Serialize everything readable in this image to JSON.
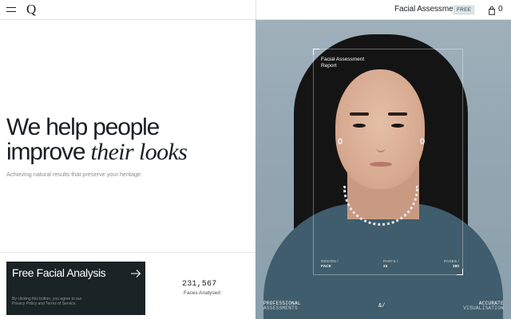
{
  "header": {
    "logo": "Q",
    "app_title": "Facial Assessment",
    "badge": "FREE",
    "cart_count": "0"
  },
  "hero": {
    "title_line1": "We help people",
    "title_line2_plain": "improve",
    "title_line2_italic": "their looks",
    "subtitle": "Achieving natural results that preserve your heritage"
  },
  "cta": {
    "title": "Free Facial Analysis",
    "legal": "By clicking this button, you agree to our Privacy Policy and Terms of Service."
  },
  "stats": {
    "number": "231,567",
    "label": "Faces Analysed"
  },
  "report": {
    "label": "Facial Assessment Report",
    "region_key": "REGION /",
    "region_value": "FACE",
    "parts_key": "PARTS /",
    "parts_value": "24",
    "pages_key": "PAGES /",
    "pages_value": "180"
  },
  "footer": {
    "left_top": "PROFESSIONAL",
    "left_bottom": "ASSESSMENTS",
    "middle": "&/",
    "right_top": "ACCURATE",
    "right_bottom": "VISUALISATION"
  },
  "icons": {
    "menu": "hamburger-menu-icon",
    "cart": "shopping-bag-icon",
    "arrow": "arrow-right-icon"
  },
  "colors": {
    "cta_background": "#1a2326",
    "badge_background": "#dfe7ec",
    "photo_background": "#9fb0bb"
  }
}
